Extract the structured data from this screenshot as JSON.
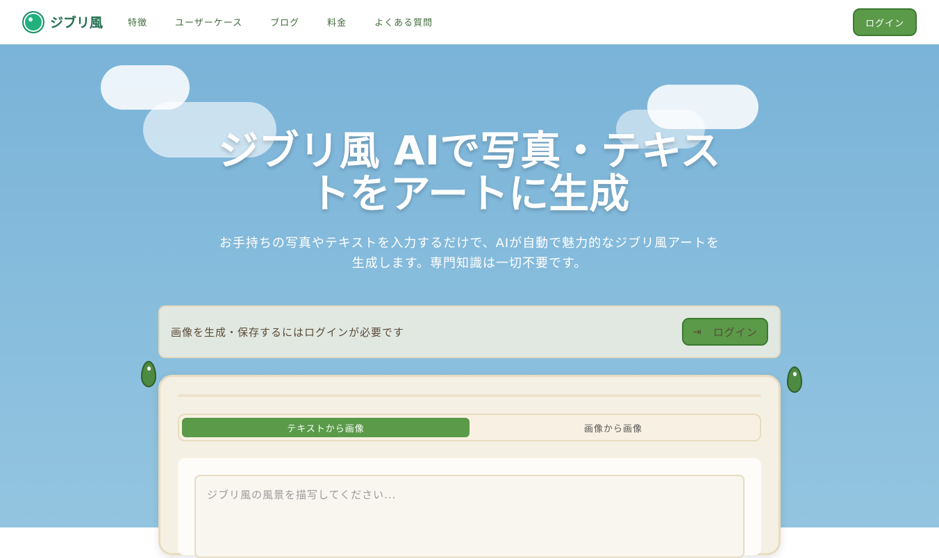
{
  "nav": {
    "brand": "ジブリ風",
    "links": [
      "特徴",
      "ユーザーケース",
      "ブログ",
      "料金",
      "よくある質問"
    ],
    "login": "ログイン"
  },
  "hero": {
    "title": "ジブリ風 AIで写真・テキストをアート に生成",
    "title_line1": "ジブリ風 AIで写真・テキス",
    "title_line2": "トをアートに生成",
    "subtitle_line1": "お手持ちの写真やテキストを入力するだけで、AIが自動で魅力的なジブリ風アートを",
    "subtitle_line2": "生成します。専門知識は一切不要です。"
  },
  "notice": {
    "text": "画像を生成・保存するにはログインが必要です",
    "login": "ログイン"
  },
  "generator": {
    "tabs": [
      "テキストから画像",
      "画像から画像"
    ],
    "active_tab": 0,
    "prompt_placeholder": "ジブリ風の風景を描写してください..."
  }
}
